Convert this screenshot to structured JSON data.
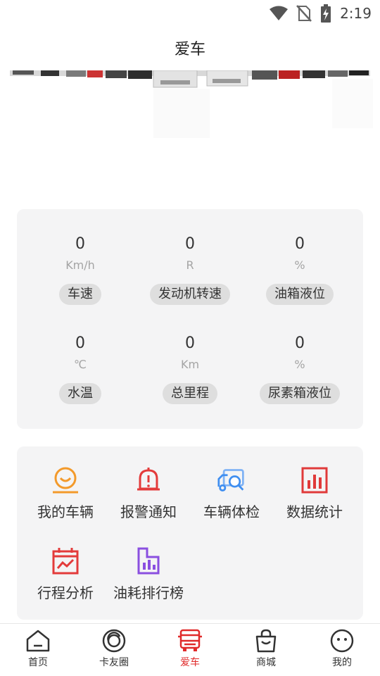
{
  "status_bar": {
    "time": "2:19"
  },
  "header": {
    "title": "爱车"
  },
  "stats": [
    {
      "value": "0",
      "unit": "Km/h",
      "label": "车速"
    },
    {
      "value": "0",
      "unit": "R",
      "label": "发动机转速"
    },
    {
      "value": "0",
      "unit": "%",
      "label": "油箱液位"
    },
    {
      "value": "0",
      "unit": "℃",
      "label": "水温"
    },
    {
      "value": "0",
      "unit": "Km",
      "label": "总里程"
    },
    {
      "value": "0",
      "unit": "%",
      "label": "尿素箱液位"
    }
  ],
  "menu": [
    {
      "label": "我的车辆",
      "icon": "my-vehicle-icon",
      "color": "#f39a2b"
    },
    {
      "label": "报警通知",
      "icon": "alarm-bell-icon",
      "color": "#e33b3b"
    },
    {
      "label": "车辆体检",
      "icon": "vehicle-inspection-icon",
      "color": "#3f8ef0"
    },
    {
      "label": "数据统计",
      "icon": "data-stats-icon",
      "color": "#e03a3a"
    },
    {
      "label": "行程分析",
      "icon": "trip-analysis-icon",
      "color": "#e33b3b"
    },
    {
      "label": "油耗排行榜",
      "icon": "fuel-ranking-icon",
      "color": "#8a4fe0"
    }
  ],
  "tabs": [
    {
      "label": "首页",
      "icon": "home-icon",
      "active": false
    },
    {
      "label": "卡友圈",
      "icon": "circle-community-icon",
      "active": false
    },
    {
      "label": "爱车",
      "icon": "truck-icon",
      "active": true
    },
    {
      "label": "商城",
      "icon": "shopping-bag-icon",
      "active": false
    },
    {
      "label": "我的",
      "icon": "profile-face-icon",
      "active": false
    }
  ],
  "colors": {
    "accent": "#e02a2a",
    "card_bg": "#f4f4f5",
    "pill_bg": "#dedede"
  }
}
